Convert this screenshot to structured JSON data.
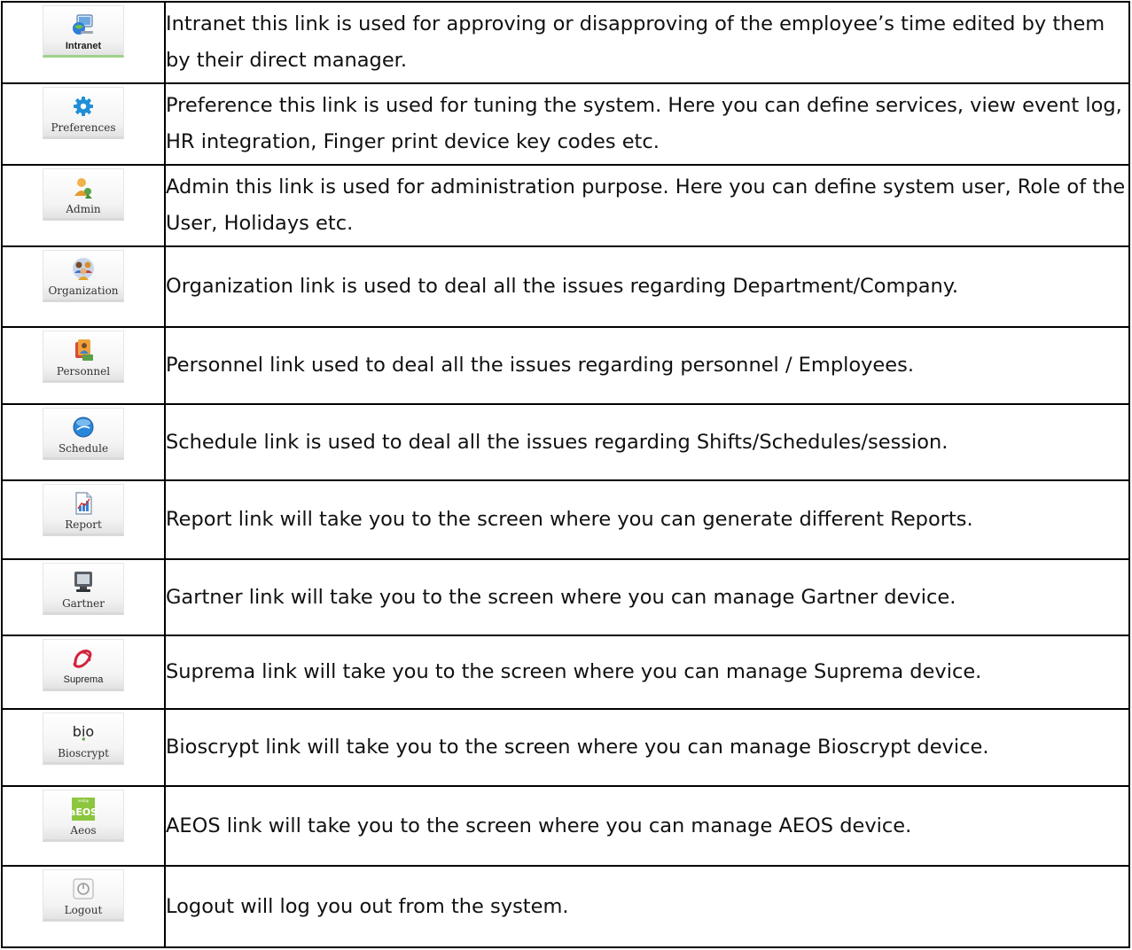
{
  "rows": [
    {
      "icon": "intranet-icon",
      "label": "Intranet",
      "text": "Intranet this link is used for approving or disapproving of the employee’s time edited by them by their direct manager."
    },
    {
      "icon": "gear-icon",
      "label": "Preferences",
      "text": "Preference this link is used for tuning the system. Here you can define services, view event log, HR integration, Finger print device key codes etc."
    },
    {
      "icon": "admin-user-icon",
      "label": "Admin",
      "text": "Admin this link is used for administration purpose. Here you can define system user, Role of the User, Holidays etc."
    },
    {
      "icon": "organization-people-icon",
      "label": "Organization",
      "text": "Organization link is used to deal all the issues regarding Department/Company."
    },
    {
      "icon": "personnel-icon",
      "label": "Personnel",
      "text": "Personnel link used to deal all the issues regarding personnel / Employees."
    },
    {
      "icon": "schedule-globe-icon",
      "label": "Schedule",
      "text": "Schedule link is used to deal all the issues regarding Shifts/Schedules/session."
    },
    {
      "icon": "report-chart-icon",
      "label": "Report",
      "text": "Report link will take you to the screen where you can generate different Reports."
    },
    {
      "icon": "gartner-monitor-icon",
      "label": "Gartner",
      "text": "Gartner link will take you to the screen where you can manage Gartner device."
    },
    {
      "icon": "suprema-logo-icon",
      "label": "Suprema",
      "text": "Suprema link will take you to the screen where you can manage Suprema device."
    },
    {
      "icon": "bioscrypt-logo-icon",
      "label": "Bioscrypt",
      "logo_text": "bio",
      "text": "Bioscrypt link will take you to the screen where you can manage Bioscrypt device."
    },
    {
      "icon": "aeos-logo-icon",
      "label": "Aeos",
      "logo_text": "aEOS",
      "logo_small": "nedap",
      "text": "AEOS link will take you to the screen where you can manage AEOS device."
    },
    {
      "icon": "power-icon",
      "label": "Logout",
      "text": "Logout will log you out from the system."
    }
  ],
  "colors": {
    "intranet_accent": "#9ed08a",
    "aeos_green": "#8cc63f",
    "suprema_red": "#d4213d",
    "schedule_blue": "#2a86d8",
    "gear_blue": "#1f8fd6"
  }
}
